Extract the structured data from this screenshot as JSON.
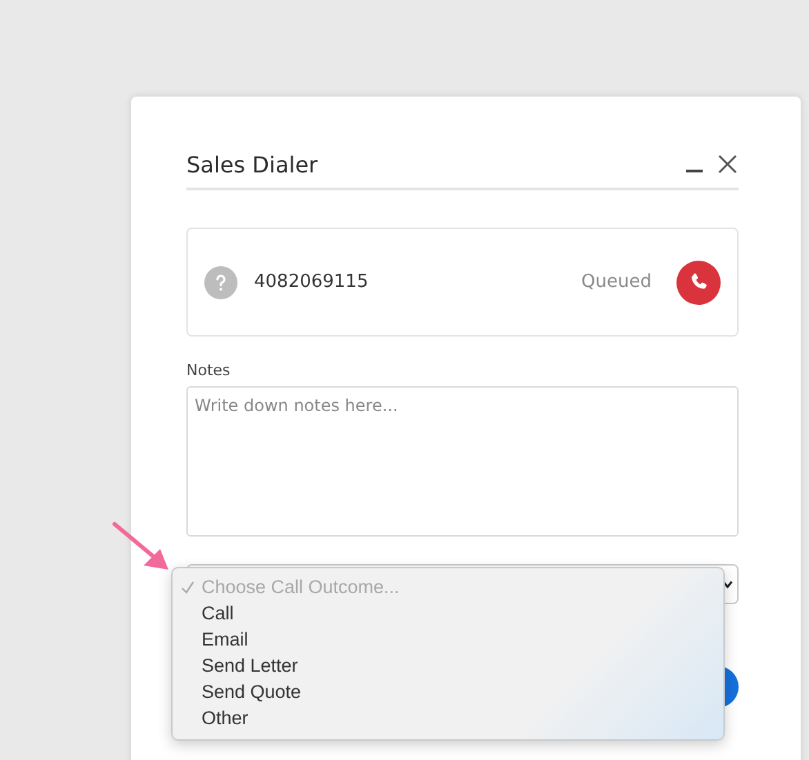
{
  "dialog": {
    "title": "Sales Dialer"
  },
  "call": {
    "number": "4082069115",
    "status": "Queued"
  },
  "notes": {
    "label": "Notes",
    "placeholder": "Write down notes here..."
  },
  "outcome_menu": {
    "options": [
      {
        "label": "Choose Call Outcome...",
        "selected": true,
        "disabled": true
      },
      {
        "label": "Call",
        "selected": false,
        "disabled": false
      },
      {
        "label": "Email",
        "selected": false,
        "disabled": false
      },
      {
        "label": "Send Letter",
        "selected": false,
        "disabled": false
      },
      {
        "label": "Send Quote",
        "selected": false,
        "disabled": false
      },
      {
        "label": "Other",
        "selected": false,
        "disabled": false
      }
    ]
  }
}
